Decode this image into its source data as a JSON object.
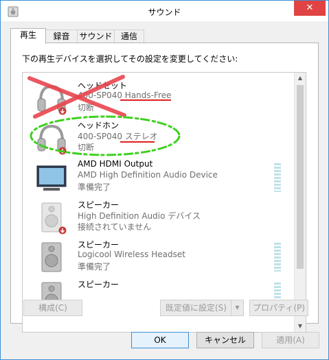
{
  "window": {
    "title": "サウンド",
    "close_label": "✕",
    "close_icon": "close-icon",
    "title_icon": "speaker-icon"
  },
  "tabs": [
    {
      "label": "再生",
      "active": true
    },
    {
      "label": "録音",
      "active": false
    },
    {
      "label": "サウンド",
      "active": false
    },
    {
      "label": "通信",
      "active": false
    }
  ],
  "instruction": "下の再生デバイスを選択してその設定を変更してください:",
  "devices": [
    {
      "name": "ヘッドセット",
      "description": "400-SP040 Hands-Free",
      "status": "切断",
      "icon": "headphones-icon",
      "disconnected": true,
      "meter": false
    },
    {
      "name": "ヘッドホン",
      "description": "400-SP040 ステレオ",
      "status": "切断",
      "icon": "headphones-icon",
      "disconnected": true,
      "meter": false
    },
    {
      "name": "AMD HDMI Output",
      "description": "AMD High Definition Audio Device",
      "status": "準備完了",
      "icon": "monitor-icon",
      "disconnected": false,
      "meter": true
    },
    {
      "name": "スピーカー",
      "description": "High Definition Audio デバイス",
      "status": "接続されていません",
      "icon": "speaker-icon",
      "disconnected": true,
      "meter": false
    },
    {
      "name": "スピーカー",
      "description": "Logicool Wireless Headset",
      "status": "準備完了",
      "icon": "speaker-icon",
      "disconnected": false,
      "meter": true
    },
    {
      "name": "スピーカー",
      "description": "",
      "status": "",
      "icon": "speaker-icon",
      "disconnected": false,
      "meter": true
    }
  ],
  "buttons": {
    "configure": "構成(C)",
    "set_default": "既定値に設定(S)",
    "properties": "プロパティ(P)",
    "ok": "OK",
    "cancel": "キャンセル",
    "apply": "適用(A)"
  },
  "annotation_colors": {
    "cross": "#e8454d",
    "underline": "#e02020",
    "ellipse": "#3fcf1f"
  }
}
